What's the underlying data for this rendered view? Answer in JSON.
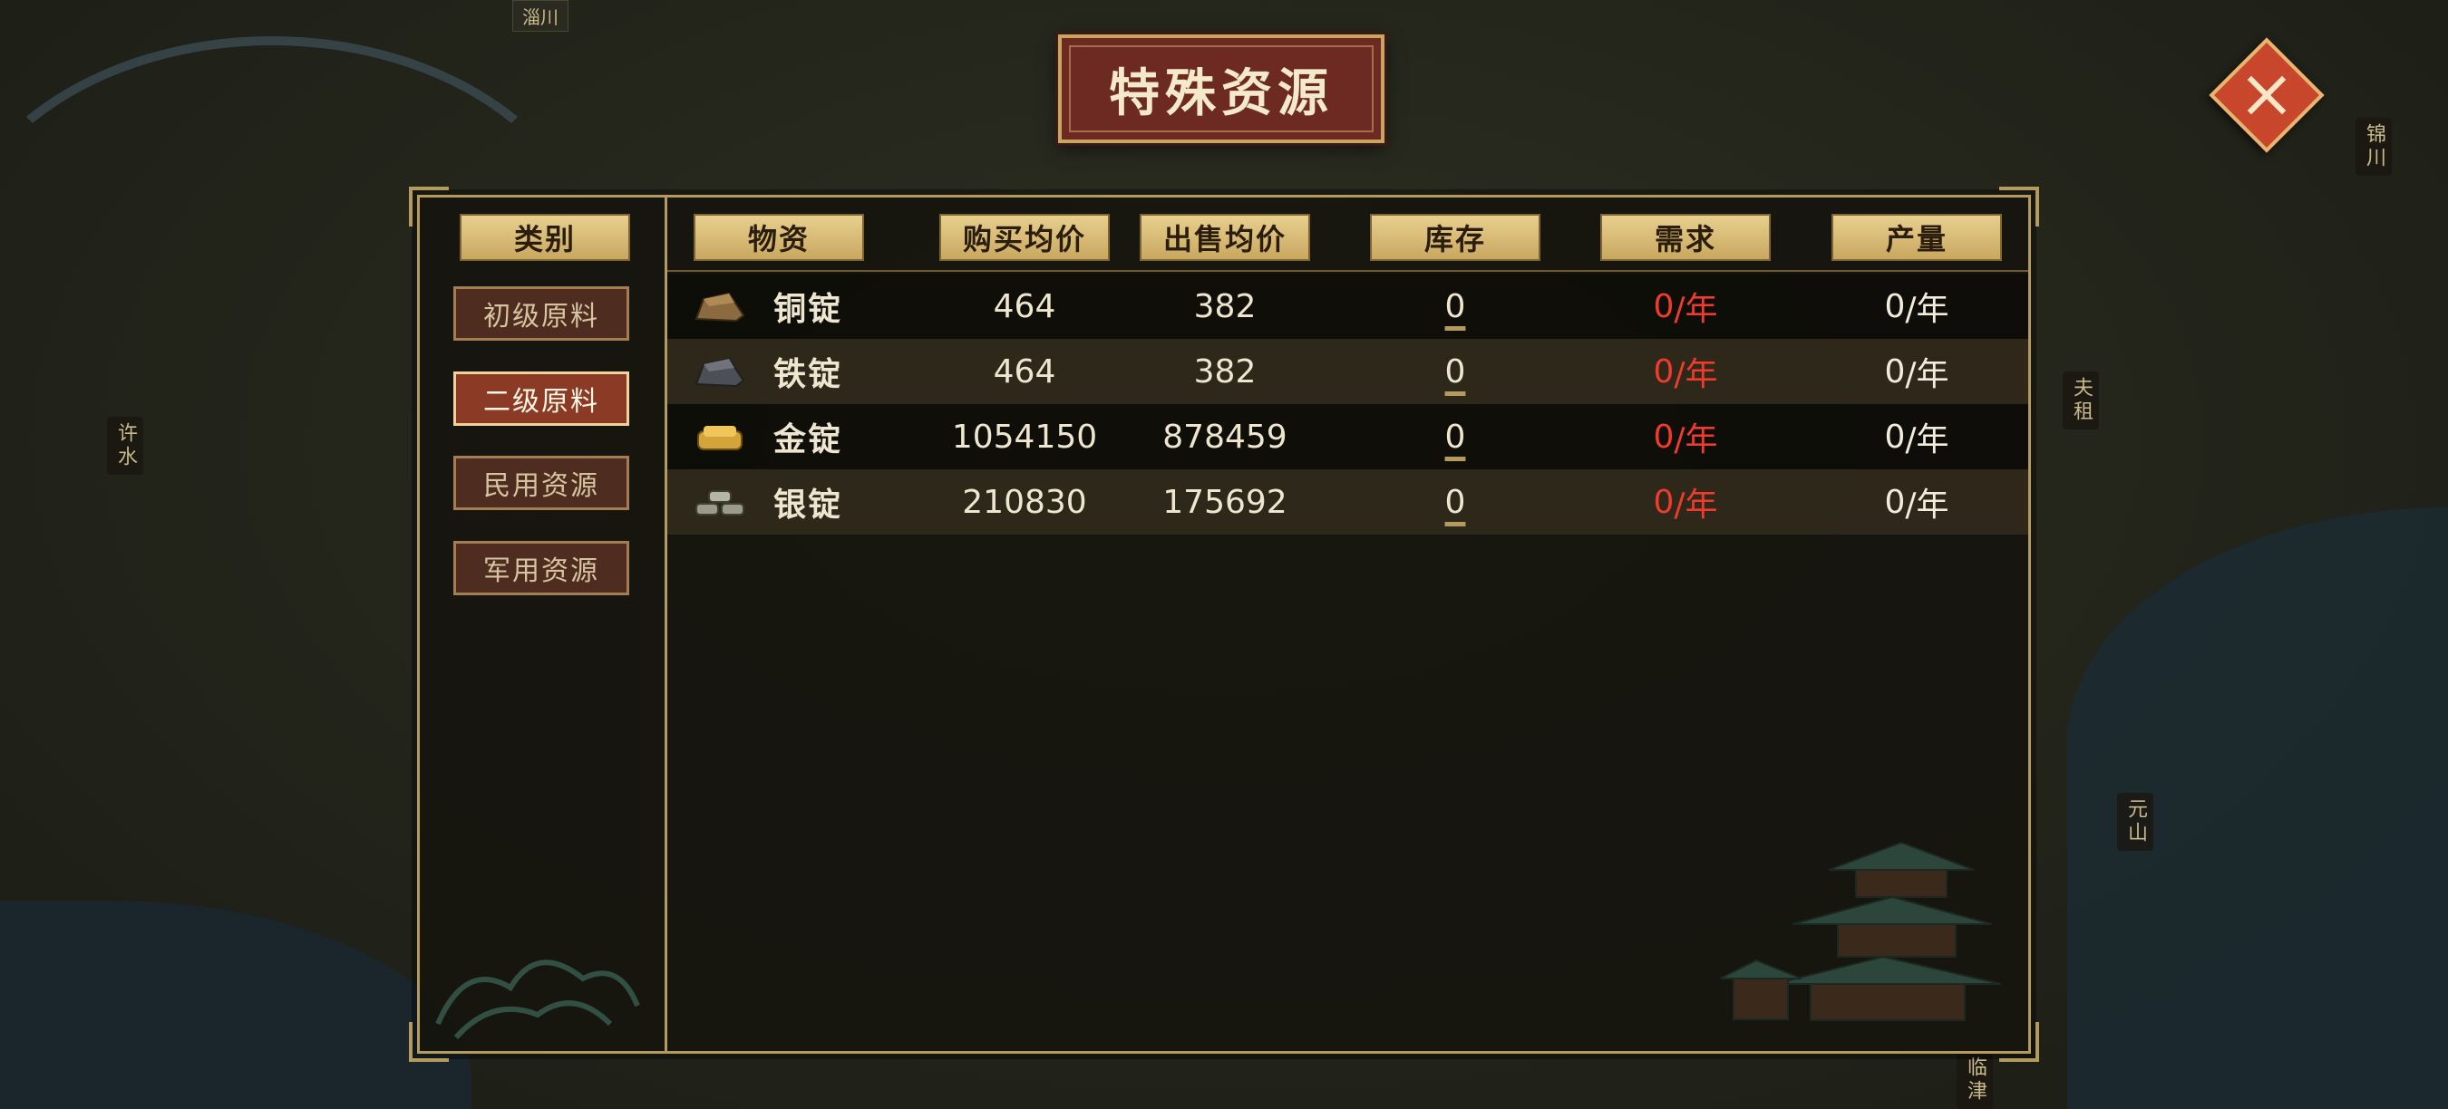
{
  "window": {
    "title": "特殊资源"
  },
  "map": {
    "top_tag": "淄川",
    "left_tag": "许水",
    "right_tags": [
      "锦川",
      "夫租",
      "元山"
    ],
    "bottom_tag": "临津"
  },
  "categories": {
    "header": "类别",
    "items": [
      {
        "label": "初级原料",
        "active": false
      },
      {
        "label": "二级原料",
        "active": true
      },
      {
        "label": "民用资源",
        "active": false
      },
      {
        "label": "军用资源",
        "active": false
      }
    ]
  },
  "table": {
    "columns": [
      "物资",
      "购买均价",
      "出售均价",
      "库存",
      "需求",
      "产量"
    ],
    "rows": [
      {
        "icon": "copper-ingot-icon",
        "icon_color": "#8c6a3f",
        "name": "铜锭",
        "buy": "464",
        "sell": "382",
        "stock": "0",
        "demand_value": "0",
        "demand_unit": "/年",
        "output_value": "0",
        "output_unit": "/年"
      },
      {
        "icon": "iron-ingot-icon",
        "icon_color": "#4d4f57",
        "name": "铁锭",
        "buy": "464",
        "sell": "382",
        "stock": "0",
        "demand_value": "0",
        "demand_unit": "/年",
        "output_value": "0",
        "output_unit": "/年"
      },
      {
        "icon": "gold-ingot-icon",
        "icon_color": "#d4a43a",
        "name": "金锭",
        "buy": "1054150",
        "sell": "878459",
        "stock": "0",
        "demand_value": "0",
        "demand_unit": "/年",
        "output_value": "0",
        "output_unit": "/年"
      },
      {
        "icon": "silver-ingot-icon",
        "icon_color": "#9a9b88",
        "name": "银锭",
        "buy": "210830",
        "sell": "175692",
        "stock": "0",
        "demand_value": "0",
        "demand_unit": "/年",
        "output_value": "0",
        "output_unit": "/年"
      }
    ]
  },
  "colors": {
    "accent_gold": "#c9a860",
    "demand_red": "#ee3b2b",
    "active_tab": "#8a3a25"
  }
}
